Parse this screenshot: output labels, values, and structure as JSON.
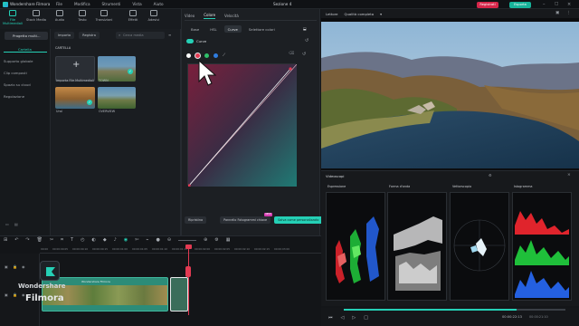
{
  "app": {
    "title": "Wondershare Filmora",
    "menu": [
      "File",
      "Modifica",
      "Strumenti",
      "Vista",
      "Aiuto"
    ],
    "project_name": "Sezione 4",
    "register_label": "Registrati",
    "export_label": "Esporta",
    "colors": {
      "accent": "#25d0b6",
      "register": "#d6264a",
      "playhead": "#e23a52"
    }
  },
  "toolstrip": [
    {
      "label": "File Multimediali",
      "icon": "media-icon",
      "active": true
    },
    {
      "label": "Stock Media",
      "icon": "stock-icon"
    },
    {
      "label": "Audio",
      "icon": "audio-icon"
    },
    {
      "label": "Testo",
      "icon": "text-icon"
    },
    {
      "label": "Transizioni",
      "icon": "transition-icon"
    },
    {
      "label": "Effetti",
      "icon": "effects-icon"
    },
    {
      "label": "Adesivi",
      "icon": "sticker-icon"
    }
  ],
  "media": {
    "project_button": "Progetto multi...",
    "folder_title": "Cartella",
    "side_items": [
      "Supporto globale",
      "Clip composti",
      "Spazio su cloud",
      "Regolazione"
    ],
    "import_label": "Importa",
    "record_label": "Registra",
    "search_placeholder": "Cerca media",
    "folder_label": "CARTELLA",
    "tiles": [
      {
        "name": "Importa File Multimediali"
      },
      {
        "name": "TOWN"
      },
      {
        "name": "Ural"
      },
      {
        "name": "OVERVIEW"
      }
    ]
  },
  "color_panel": {
    "tabs": [
      "Video",
      "Colore",
      "Velocità"
    ],
    "active_tab": "Colore",
    "subtabs": [
      "Base",
      "HSL",
      "Curve",
      "Selettore colori"
    ],
    "active_subtab": "Curve",
    "curve_label": "Curve",
    "bottom": {
      "reset": "Ripristina",
      "keyframe": "Pannello Fotogrammi chiave",
      "save": "Salva come personalizzato",
      "new_badge": "NEW"
    }
  },
  "viewer": {
    "label": "Lettore",
    "quality": "Qualità completa"
  },
  "scopes": {
    "title": "Videoscopi",
    "panels": [
      "Espressione",
      "Forma d'onda",
      "Vettorscopio",
      "Istogramma"
    ]
  },
  "playback": {
    "timecode": "00:00:22:13",
    "timecode_total": "00:00:21:10",
    "progress": 0.78
  },
  "timeline": {
    "ticks": [
      "00:00",
      "00:00:00:05",
      "00:00:00:10",
      "00:00:00:15",
      "00:00:01:00",
      "00:00:01:05",
      "00:00:01:10",
      "00:00:01:15",
      "00:00:02:00",
      "00:00:02:05",
      "00:00:02:10",
      "00:00:02:15",
      "00:00:03:00"
    ],
    "clip_label": "Wondershare Filmora",
    "watermark_line1": "Wondershare",
    "watermark_line2": "Filmora"
  }
}
